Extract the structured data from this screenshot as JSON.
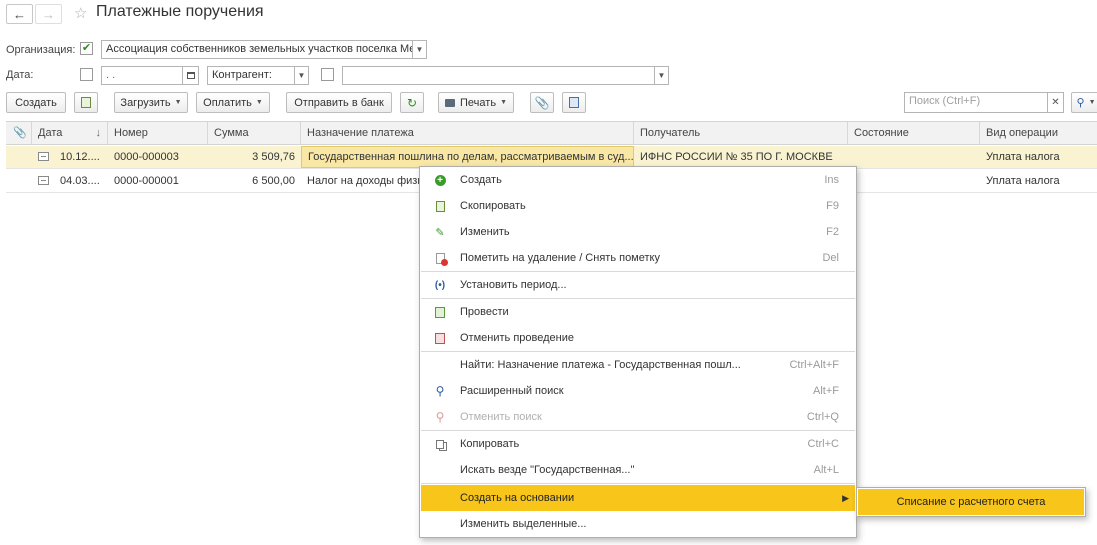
{
  "window": {
    "title": "Платежные поручения"
  },
  "filters": {
    "organization_label": "Организация:",
    "organization_value": "Ассоциация собственников земельных участков поселка Мел",
    "date_label": "Дата:",
    "date_value": ".   .",
    "counterparty_label": "Контрагент:",
    "counterparty_value": ""
  },
  "toolbar": {
    "create": "Создать",
    "load": "Загрузить",
    "pay": "Оплатить",
    "send_to_bank": "Отправить в банк",
    "print": "Печать",
    "search_placeholder": "Поиск (Ctrl+F)"
  },
  "table": {
    "columns": [
      "Дата",
      "Номер",
      "Сумма",
      "Назначение платежа",
      "Получатель",
      "Состояние",
      "Вид операции"
    ],
    "rows": [
      {
        "date": "10.12....",
        "number": "0000-000003",
        "sum": "3 509,76",
        "purpose": "Государственная пошлина по делам, рассматриваемым в суд...",
        "recipient": "ИФНС РОССИИ № 35 ПО Г. МОСКВЕ",
        "state": "",
        "operation": "Уплата налога"
      },
      {
        "date": "04.03....",
        "number": "0000-000001",
        "sum": "6 500,00",
        "purpose": "Налог на доходы физич",
        "recipient": "",
        "state": "",
        "operation": "Уплата налога"
      }
    ]
  },
  "context_menu": {
    "items": [
      {
        "label": "Создать",
        "shortcut": "Ins"
      },
      {
        "label": "Скопировать",
        "shortcut": "F9"
      },
      {
        "label": "Изменить",
        "shortcut": "F2"
      },
      {
        "label": "Пометить на удаление / Снять пометку",
        "shortcut": "Del"
      },
      {
        "label": "Установить период...",
        "shortcut": ""
      },
      {
        "label": "Провести",
        "shortcut": ""
      },
      {
        "label": "Отменить проведение",
        "shortcut": ""
      },
      {
        "label": "Найти: Назначение платежа - Государственная пошл...",
        "shortcut": "Ctrl+Alt+F"
      },
      {
        "label": "Расширенный поиск",
        "shortcut": "Alt+F"
      },
      {
        "label": "Отменить поиск",
        "shortcut": "Ctrl+Q"
      },
      {
        "label": "Копировать",
        "shortcut": "Ctrl+C"
      },
      {
        "label": "Искать везде \"Государственная...\"",
        "shortcut": "Alt+L"
      },
      {
        "label": "Создать на основании",
        "shortcut": ""
      },
      {
        "label": "Изменить выделенные...",
        "shortcut": ""
      }
    ],
    "submenu": {
      "label": "Списание с расчетного счета"
    }
  },
  "colors": {
    "highlight": "#f8c51a",
    "selected_row": "#faf3d1",
    "check": "#2e8b1e"
  }
}
